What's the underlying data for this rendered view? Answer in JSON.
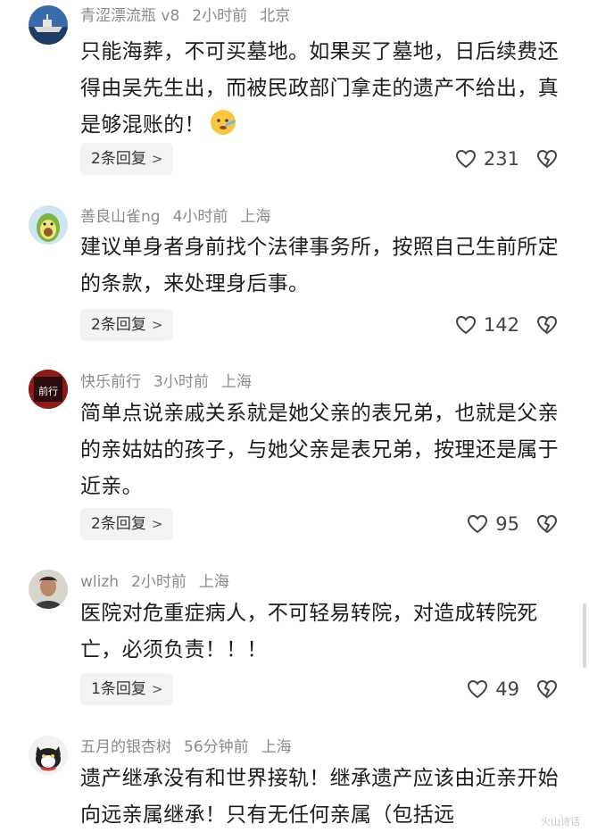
{
  "comments": [
    {
      "username": "青涩漂流瓶 v8",
      "time": "2小时前",
      "location": "北京",
      "text": "只能海葬，不可买墓地。如果买了墓地，日后续费还得由吴先生出，而被民政部门拿走的遗产不给出，真是够混账的！",
      "emoji": "face-with-thermometer-emoji",
      "reply_label": "2条回复",
      "likes": "231",
      "avatar": "ship-avatar"
    },
    {
      "username": "善良山雀ng",
      "time": "4小时前",
      "location": "上海",
      "text": "建议单身者身前找个法律事务所，按照自己生前所定的条款，来处理身后事。",
      "reply_label": "2条回复",
      "likes": "142",
      "avatar": "avocado-avatar"
    },
    {
      "username": "快乐前行",
      "time": "3小时前",
      "location": "上海",
      "text": "简单点说亲戚关系就是她父亲的表兄弟，也就是父亲的亲姑姑的孩子，与她父亲是表兄弟，按理还是属于近亲。",
      "reply_label": "2条回复",
      "likes": "95",
      "avatar": "calligraphy-avatar",
      "avatar_text": "前行"
    },
    {
      "username": "wlizh",
      "time": "2小时前",
      "location": "上海",
      "text": "医院对危重症病人，不可轻易转院，对造成转院死亡，必须负责！！！",
      "reply_label": "1条回复",
      "likes": "49",
      "avatar": "portrait-avatar"
    },
    {
      "username": "五月的银杏树",
      "time": "56分钟前",
      "location": "上海",
      "text": "遗产继承没有和世界接轨！继承遗产应该由近亲开始向远亲属继承！只有无任何亲属（包括远",
      "avatar": "cat-avatar"
    }
  ],
  "watermark": "火山诗话",
  "colors": {
    "meta": "#8a8a8a",
    "reply_bg": "#f3f3f3",
    "text": "#1c1c1c"
  }
}
